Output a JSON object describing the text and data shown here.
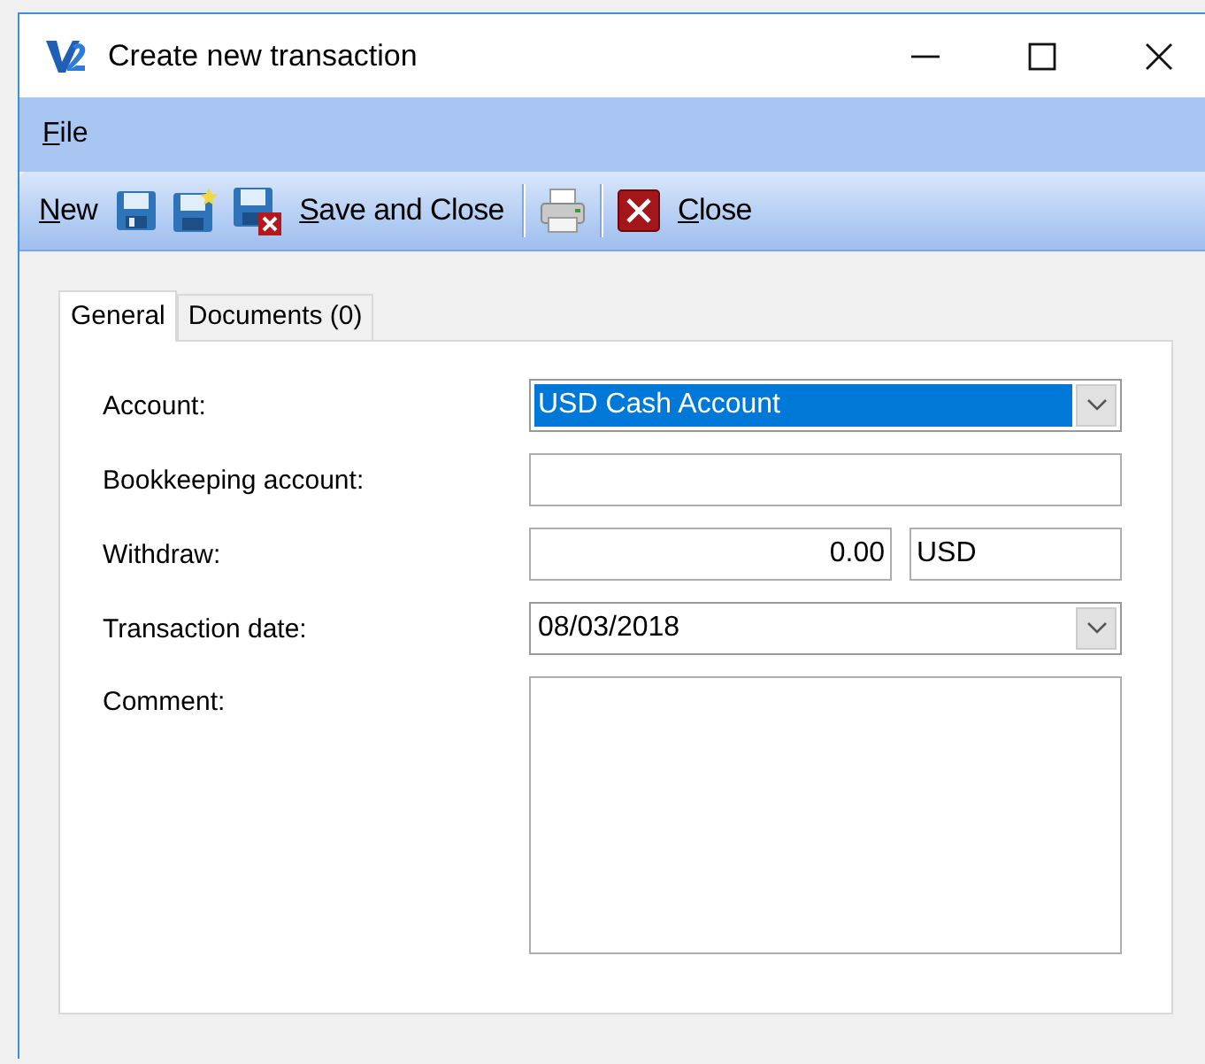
{
  "window": {
    "title": "Create new transaction"
  },
  "menu": [
    {
      "label": "File"
    }
  ],
  "toolbar": [
    {
      "kind": "text",
      "label": "New"
    },
    {
      "kind": "icon"
    },
    {
      "kind": "icon"
    },
    {
      "kind": "icon"
    },
    {
      "kind": "text",
      "label": "Save and Close"
    },
    {
      "kind": "separator"
    },
    {
      "kind": "icon"
    },
    {
      "kind": "separator"
    },
    {
      "kind": "icon"
    },
    {
      "kind": "text",
      "label": "Close"
    }
  ],
  "tabs": [
    {
      "label": "General",
      "selected": true
    },
    {
      "label": "Documents (0)",
      "selected": false
    }
  ],
  "form": [
    {
      "kind": "combo",
      "label": "Account:",
      "value": "USD Cash Account",
      "highlighted": true
    },
    {
      "kind": "text",
      "label": "Bookkeeping account:"
    },
    {
      "kind": "amount",
      "label": "Withdraw:",
      "value": "0.00",
      "currency": "USD"
    },
    {
      "kind": "combo",
      "label": "Transaction date:",
      "value": "08/03/2018",
      "highlighted": false
    },
    {
      "kind": "memo",
      "label": "Comment:"
    }
  ]
}
